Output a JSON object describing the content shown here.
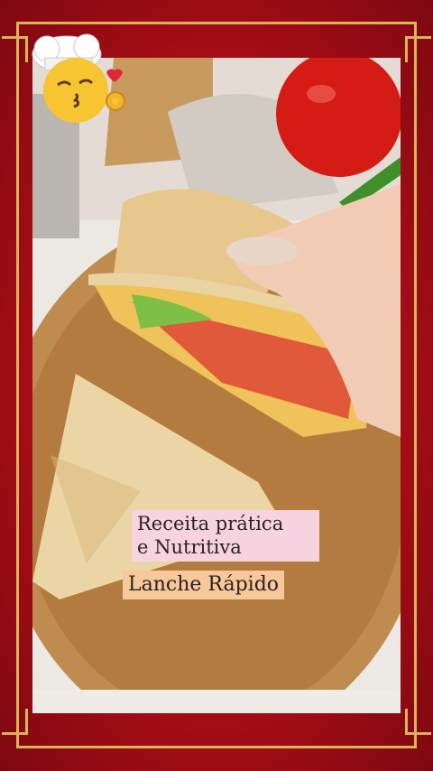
{
  "caption": {
    "line1": "Receita prática",
    "line2": "e Nutritiva",
    "highlight": "Lanche Rápido"
  },
  "icons": {
    "chef_emoji": "chef-kiss-emoji-icon"
  },
  "colors": {
    "frame_red": "#b3101a",
    "border_gold": "#d9b45a",
    "caption_pink": "#f6d3df",
    "caption_orange": "#f7c89a"
  }
}
